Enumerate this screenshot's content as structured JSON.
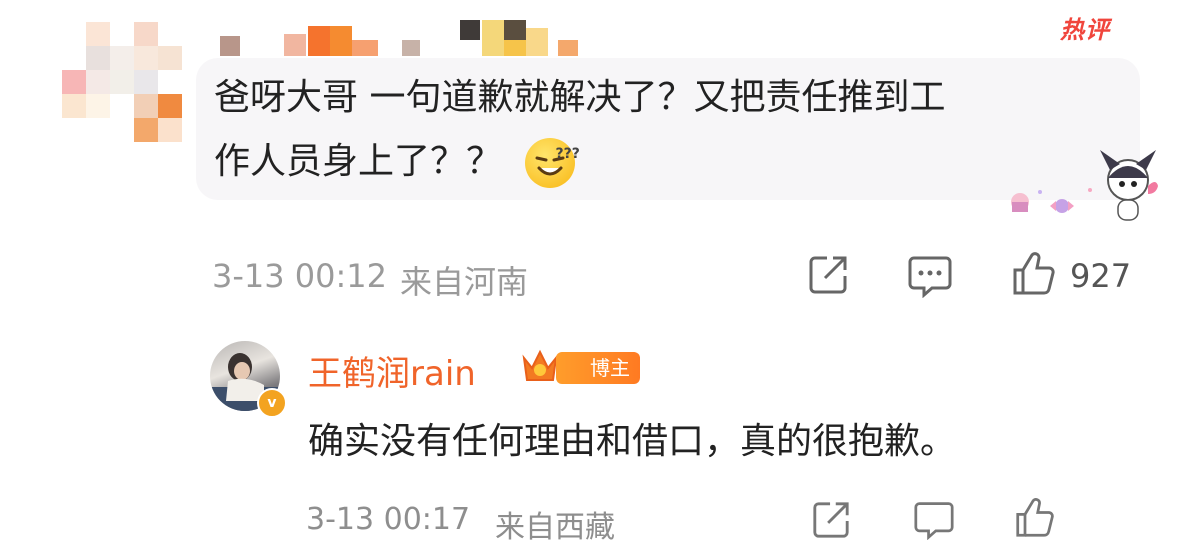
{
  "top_comment": {
    "hot_label": "热评",
    "line1": "爸呀大哥 一句道歉就解决了？又把责任推到工",
    "line2": "作人员身上了？？",
    "emoji_name": "squint-face-emoji",
    "timestamp": "3-13 00:12",
    "location": "来自河南",
    "like_count": "927"
  },
  "reply": {
    "author": "王鹤润rain",
    "author_badge": "博主",
    "text": "确实没有任何理由和借口，真的很抱歉。",
    "timestamp": "3-13 00:17",
    "location": "来自西藏"
  },
  "colors": {
    "hot": "#f0453c",
    "author": "#f0642a",
    "badge": "#ff8a25",
    "meta": "#9a9a9a"
  }
}
